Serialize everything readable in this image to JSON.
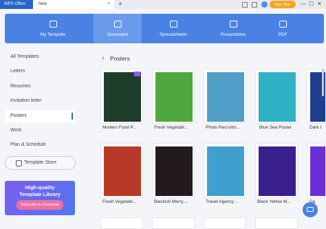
{
  "titlebar": {
    "app_tab": "WPS Office",
    "new_tab": "New",
    "close_tab": "×",
    "add_tab": "+",
    "free_trial": "Free Trial",
    "minimize": "—",
    "maximize": "☐",
    "close": "✕"
  },
  "categories": [
    {
      "label": "My Template"
    },
    {
      "label": "Document"
    },
    {
      "label": "Spreadsheets"
    },
    {
      "label": "Presentation"
    },
    {
      "label": "PDF"
    }
  ],
  "sidebar": {
    "items": [
      {
        "label": "All Templates"
      },
      {
        "label": "Letters"
      },
      {
        "label": "Resumes"
      },
      {
        "label": "Invitation letter"
      },
      {
        "label": "Posters"
      },
      {
        "label": "Work"
      },
      {
        "label": "Plan & Schedule"
      }
    ],
    "store_button": "Template Store",
    "promo_line1": "High-quality",
    "promo_line2": "Template Library",
    "promo_cta": "Subscribe to Download"
  },
  "main": {
    "back": "‹",
    "section_title": "Posters",
    "cards": [
      {
        "label": "Modern Food P...",
        "color": "#1f3d2b"
      },
      {
        "label": "Fresh Vegetabl...",
        "color": "#4fa83d"
      },
      {
        "label": "Photo Recruitm...",
        "color": "#4f9fc9"
      },
      {
        "label": "Blue Sea Poster",
        "color": "#2fb2c6"
      },
      {
        "label": "Dark I",
        "color": "#1d3f8f"
      },
      {
        "label": "Fresh Vegetabl...",
        "color": "#b83a26"
      },
      {
        "label": "Blackish Merry ...",
        "color": "#231a1f"
      },
      {
        "label": "Travel Agency ...",
        "color": "#3fa0cf"
      },
      {
        "label": "Black Yellow M...",
        "color": "#3a1f8f"
      },
      {
        "label": "Da",
        "color": "#6b2fd8"
      }
    ]
  }
}
